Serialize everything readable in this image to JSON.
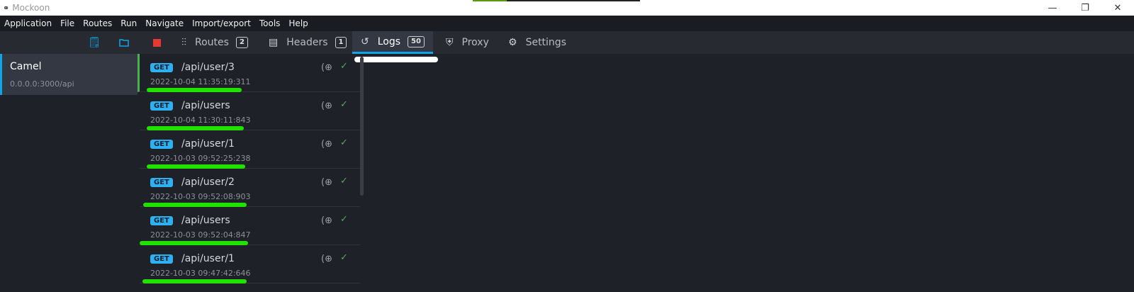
{
  "window": {
    "title": "Mockoon",
    "controls": [
      "minimize",
      "restore",
      "close"
    ]
  },
  "menu": [
    "Application",
    "File",
    "Routes",
    "Run",
    "Navigate",
    "Import/export",
    "Tools",
    "Help"
  ],
  "toolbar": {
    "accent": "#0ea5e9",
    "stop_color": "#e53935"
  },
  "tabs": [
    {
      "label": "Routes",
      "badge": "2",
      "icon": "routes-icon"
    },
    {
      "label": "Headers",
      "badge": "1",
      "icon": "headers-icon"
    },
    {
      "label": "Logs",
      "badge": "50",
      "icon": "history-icon",
      "active": true
    },
    {
      "label": "Proxy",
      "icon": "shield-icon"
    },
    {
      "label": "Settings",
      "icon": "gear-icon"
    }
  ],
  "environment": {
    "name": "Camel",
    "host": "0.0.0.0:3000/api"
  },
  "logs": [
    {
      "method": "GET",
      "path": "/api/user/3",
      "timestamp": "2022-10-04 11:35:19:311"
    },
    {
      "method": "GET",
      "path": "/api/users",
      "timestamp": "2022-10-04 11:30:11:843"
    },
    {
      "method": "GET",
      "path": "/api/user/1",
      "timestamp": "2022-10-03 09:52:25:238"
    },
    {
      "method": "GET",
      "path": "/api/user/2",
      "timestamp": "2022-10-03 09:52:08:903"
    },
    {
      "method": "GET",
      "path": "/api/users",
      "timestamp": "2022-10-03 09:52:04:847"
    },
    {
      "method": "GET",
      "path": "/api/user/1",
      "timestamp": "2022-10-03 09:47:42:646"
    }
  ]
}
